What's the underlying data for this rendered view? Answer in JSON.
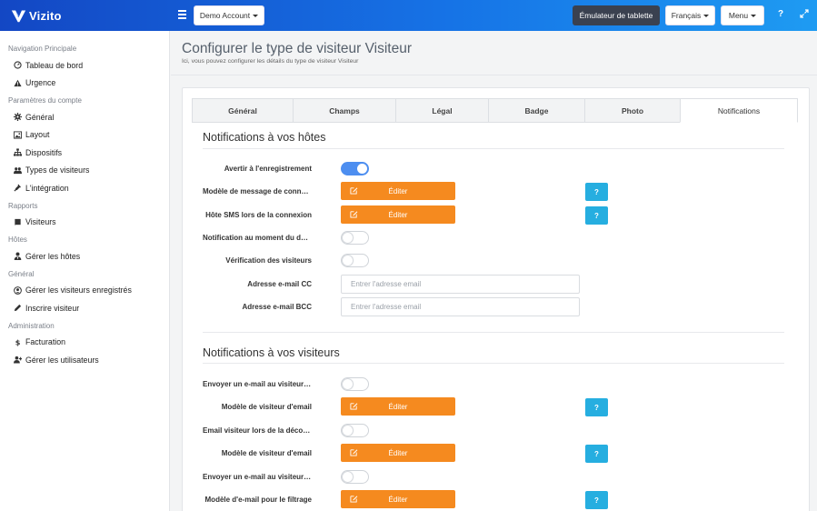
{
  "header": {
    "brand": "Vizito",
    "account_label": "Demo Account",
    "tablet_label": "Émulateur de tablette",
    "language_label": "Français",
    "menu_label": "Menu",
    "help_icon": "?",
    "brand_color": "#1673e6"
  },
  "sidebar": {
    "sections": [
      {
        "title": "Navigation Principale",
        "items": [
          {
            "label": "Tableau de bord",
            "icon": "dashboard-icon"
          },
          {
            "label": "Urgence",
            "icon": "warning-icon"
          }
        ]
      },
      {
        "title": "Paramètres du compte",
        "items": [
          {
            "label": "Général",
            "icon": "gear-icon"
          },
          {
            "label": "Layout",
            "icon": "image-icon"
          },
          {
            "label": "Dispositifs",
            "icon": "sitemap-icon"
          },
          {
            "label": "Types de visiteurs",
            "icon": "users-icon"
          },
          {
            "label": "L'intégration",
            "icon": "plug-icon"
          }
        ]
      },
      {
        "title": "Rapports",
        "items": [
          {
            "label": "Visiteurs",
            "icon": "book-icon"
          }
        ]
      },
      {
        "title": "Hôtes",
        "items": [
          {
            "label": "Gérer les hôtes",
            "icon": "user-tie-icon"
          }
        ]
      },
      {
        "title": "Général",
        "items": [
          {
            "label": "Gérer les visiteurs enregistrés",
            "icon": "user-circle-icon"
          },
          {
            "label": "Inscrire visiteur",
            "icon": "pencil-icon"
          }
        ]
      },
      {
        "title": "Administration",
        "items": [
          {
            "label": "Facturation",
            "icon": "dollar-icon"
          },
          {
            "label": "Gérer les utilisateurs",
            "icon": "user-plus-icon"
          }
        ]
      }
    ]
  },
  "page": {
    "title": "Configurer le type de visiteur Visiteur",
    "subtitle": "Ici, vous pouvez configurer les détails du type de visiteur Visiteur"
  },
  "tabs": [
    "Général",
    "Champs",
    "Légal",
    "Badge",
    "Photo",
    "Notifications"
  ],
  "active_tab": "Notifications",
  "hosts_section": {
    "title": "Notifications à vos hôtes",
    "notify_on_checkin": "Avertir à l'enregistrement",
    "checkin_template": "Modèle de message de connexion",
    "sms_host": "Hôte SMS lors de la connexion",
    "notify_on_checkout": "Notification au moment du départ",
    "visitor_verification": "Vérification des visiteurs",
    "cc_label": "Adresse e-mail CC",
    "bcc_label": "Adresse e-mail BCC",
    "email_placeholder": "Entrer l'adresse email"
  },
  "visitors_section": {
    "title": "Notifications à vos visiteurs",
    "send_email_1": "Envoyer un e-mail au visiteur lors de l'enregistrement",
    "visitor_template_1": "Modèle de visiteur d'email",
    "checkout_email": "Email visiteur lors de la déconnexion",
    "visitor_template_2": "Modèle de visiteur d'email",
    "send_email_2": "Envoyer un e-mail au visiteur lors du filtrage",
    "filter_template": "Modèle d'e-mail pour le filtrage"
  },
  "edit_label": "Éditer",
  "help_label": "?",
  "colors": {
    "edit": "#f58a1f",
    "help": "#26aee0",
    "toggle_on": "#4d8ef0"
  }
}
